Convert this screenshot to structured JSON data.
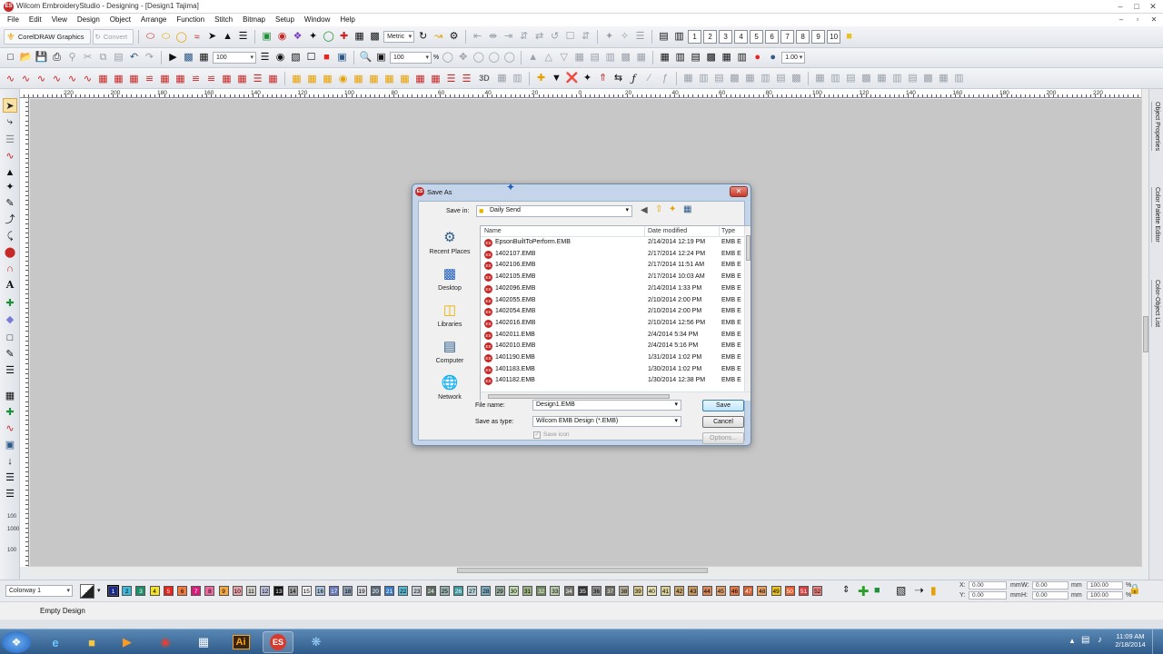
{
  "window": {
    "title": "Wilcom EmbroideryStudio - Designing - [Design1      Tajima]",
    "app_icon": "ES",
    "controls": [
      "–",
      "□",
      "✕"
    ]
  },
  "menu": {
    "items": [
      "File",
      "Edit",
      "View",
      "Design",
      "Object",
      "Arrange",
      "Function",
      "Stitch",
      "Bitmap",
      "Setup",
      "Window",
      "Help"
    ],
    "mdi_controls": [
      "–",
      "▫",
      "✕"
    ]
  },
  "toolbar": {
    "coreldraw_label": "CorelDRAW Graphics",
    "convert_label": "Convert",
    "units_value": "Metric",
    "number_buttons": [
      "1",
      "2",
      "3",
      "4",
      "5",
      "6",
      "7",
      "8",
      "9",
      "10"
    ],
    "zoom_value_1": "100",
    "zoom_value_2": "100",
    "zoom_value_3": "1.00",
    "zoom_unit": "%",
    "label_3d": "3D"
  },
  "ruler": {
    "h_ticks": [
      "220",
      "200",
      "180",
      "160",
      "140",
      "120",
      "100",
      "80",
      "60",
      "40",
      "20",
      "0",
      "20",
      "40",
      "60",
      "80",
      "100",
      "120",
      "140",
      "160",
      "180",
      "200",
      "220"
    ],
    "v_ticks": [
      "100",
      "1000",
      "100"
    ]
  },
  "dock_tabs": [
    "Object Properties",
    "Color Palette Editor",
    "Color-Object List"
  ],
  "dialog": {
    "title": "Save As",
    "icon": "ES",
    "save_in_label": "Save in:",
    "save_in_value": "Daily Send",
    "places": [
      "Recent Places",
      "Desktop",
      "Libraries",
      "Computer",
      "Network"
    ],
    "columns": [
      "Name",
      "Date modified",
      "Type"
    ],
    "files": [
      {
        "name": "EpsonBuiltToPerform.EMB",
        "date": "2/14/2014 12:19 PM",
        "type": "EMB E"
      },
      {
        "name": "1402107.EMB",
        "date": "2/17/2014 12:24 PM",
        "type": "EMB E"
      },
      {
        "name": "1402106.EMB",
        "date": "2/17/2014 11:51 AM",
        "type": "EMB E"
      },
      {
        "name": "1402105.EMB",
        "date": "2/17/2014 10:03 AM",
        "type": "EMB E"
      },
      {
        "name": "1402096.EMB",
        "date": "2/14/2014 1:33 PM",
        "type": "EMB E"
      },
      {
        "name": "1402055.EMB",
        "date": "2/10/2014 2:00 PM",
        "type": "EMB E"
      },
      {
        "name": "1402054.EMB",
        "date": "2/10/2014 2:00 PM",
        "type": "EMB E"
      },
      {
        "name": "1402016.EMB",
        "date": "2/10/2014 12:56 PM",
        "type": "EMB E"
      },
      {
        "name": "1402011.EMB",
        "date": "2/4/2014 5:34 PM",
        "type": "EMB E"
      },
      {
        "name": "1402010.EMB",
        "date": "2/4/2014 5:16 PM",
        "type": "EMB E"
      },
      {
        "name": "1401190.EMB",
        "date": "1/31/2014 1:02 PM",
        "type": "EMB E"
      },
      {
        "name": "1401183.EMB",
        "date": "1/30/2014 1:02 PM",
        "type": "EMB E"
      },
      {
        "name": "1401182.EMB",
        "date": "1/30/2014 12:38 PM",
        "type": "EMB E"
      }
    ],
    "file_name_label": "File name:",
    "file_name_value": "Design1.EMB",
    "save_as_type_label": "Save as type:",
    "save_as_type_value": "Wilcom EMB Design (*.EMB)",
    "save_icon_label": "Save icon",
    "save_button": "Save",
    "cancel_button": "Cancel",
    "options_button": "Options..."
  },
  "colorbar": {
    "colorway": "Colorway 1",
    "chips": [
      {
        "n": "1",
        "c": "#1a2a8c",
        "t": "#fff"
      },
      {
        "n": "2",
        "c": "#40b8d8",
        "t": "#000"
      },
      {
        "n": "3",
        "c": "#1f8f6a",
        "t": "#fff"
      },
      {
        "n": "4",
        "c": "#f4e22a",
        "t": "#000"
      },
      {
        "n": "5",
        "c": "#e8231e",
        "t": "#fff"
      },
      {
        "n": "6",
        "c": "#f07a40",
        "t": "#000"
      },
      {
        "n": "7",
        "c": "#d81b7a",
        "t": "#fff"
      },
      {
        "n": "8",
        "c": "#e86aa0",
        "t": "#000"
      },
      {
        "n": "9",
        "c": "#f4a640",
        "t": "#000"
      },
      {
        "n": "10",
        "c": "#e6a0a8",
        "t": "#000"
      },
      {
        "n": "11",
        "c": "#d0cfc8",
        "t": "#000"
      },
      {
        "n": "12",
        "c": "#b8bcd8",
        "t": "#000"
      },
      {
        "n": "13",
        "c": "#111111",
        "t": "#fff"
      },
      {
        "n": "14",
        "c": "#9a9a9a",
        "t": "#000"
      },
      {
        "n": "15",
        "c": "#f4f4f4",
        "t": "#000"
      },
      {
        "n": "16",
        "c": "#a8c0d8",
        "t": "#000"
      },
      {
        "n": "17",
        "c": "#6878b8",
        "t": "#fff"
      },
      {
        "n": "18",
        "c": "#8a9ab0",
        "t": "#000"
      },
      {
        "n": "19",
        "c": "#d8d8e0",
        "t": "#000"
      },
      {
        "n": "20",
        "c": "#5a6a78",
        "t": "#fff"
      },
      {
        "n": "21",
        "c": "#3a7ac0",
        "t": "#fff"
      },
      {
        "n": "22",
        "c": "#5ab8d0",
        "t": "#000"
      },
      {
        "n": "23",
        "c": "#c8cfd8",
        "t": "#000"
      },
      {
        "n": "24",
        "c": "#5a6a60",
        "t": "#fff"
      },
      {
        "n": "25",
        "c": "#9ab0b0",
        "t": "#000"
      },
      {
        "n": "26",
        "c": "#3a9aa0",
        "t": "#fff"
      },
      {
        "n": "27",
        "c": "#b8d0d8",
        "t": "#000"
      },
      {
        "n": "28",
        "c": "#7aa8c0",
        "t": "#000"
      },
      {
        "n": "29",
        "c": "#98b0a0",
        "t": "#000"
      },
      {
        "n": "30",
        "c": "#c0d8b0",
        "t": "#000"
      },
      {
        "n": "31",
        "c": "#9ab080",
        "t": "#000"
      },
      {
        "n": "32",
        "c": "#708860",
        "t": "#fff"
      },
      {
        "n": "33",
        "c": "#b8c8a8",
        "t": "#000"
      },
      {
        "n": "34",
        "c": "#707068",
        "t": "#fff"
      },
      {
        "n": "35",
        "c": "#303030",
        "t": "#fff"
      },
      {
        "n": "36",
        "c": "#8a8a8a",
        "t": "#000"
      },
      {
        "n": "37",
        "c": "#6a6a60",
        "t": "#fff"
      },
      {
        "n": "38",
        "c": "#b0a890",
        "t": "#000"
      },
      {
        "n": "39",
        "c": "#d8c890",
        "t": "#000"
      },
      {
        "n": "40",
        "c": "#e8e0b0",
        "t": "#000"
      },
      {
        "n": "41",
        "c": "#d8d098",
        "t": "#000"
      },
      {
        "n": "42",
        "c": "#c8a870",
        "t": "#000"
      },
      {
        "n": "43",
        "c": "#c89860",
        "t": "#000"
      },
      {
        "n": "44",
        "c": "#d88858",
        "t": "#000"
      },
      {
        "n": "45",
        "c": "#e0a070",
        "t": "#000"
      },
      {
        "n": "46",
        "c": "#e07848",
        "t": "#000"
      },
      {
        "n": "47",
        "c": "#d86030",
        "t": "#fff"
      },
      {
        "n": "48",
        "c": "#e8a060",
        "t": "#000"
      },
      {
        "n": "49",
        "c": "#e8c020",
        "t": "#000"
      },
      {
        "n": "50",
        "c": "#e86030",
        "t": "#fff"
      },
      {
        "n": "51",
        "c": "#d84040",
        "t": "#fff"
      },
      {
        "n": "52",
        "c": "#e88080",
        "t": "#000"
      }
    ]
  },
  "coords": {
    "x_label": "X:",
    "x_value": "0.00",
    "y_label": "Y:",
    "y_value": "0.00",
    "w_label": "W:",
    "w_value": "0.00",
    "h_label": "H:",
    "h_value": "0.00",
    "unit": "mm",
    "pct1": "100.00",
    "pct2": "100.00",
    "pct_unit": "%"
  },
  "status": {
    "text": "Empty Design"
  },
  "taskbar": {
    "apps": [
      "start-orb",
      "internet-explorer",
      "file-explorer",
      "media-player",
      "chrome",
      "apps-grid",
      "illustrator",
      "embroidery-studio",
      "utility"
    ],
    "illustrator_label": "Ai",
    "es_label": "ES",
    "time": "11:09 AM",
    "date": "2/18/2014"
  }
}
